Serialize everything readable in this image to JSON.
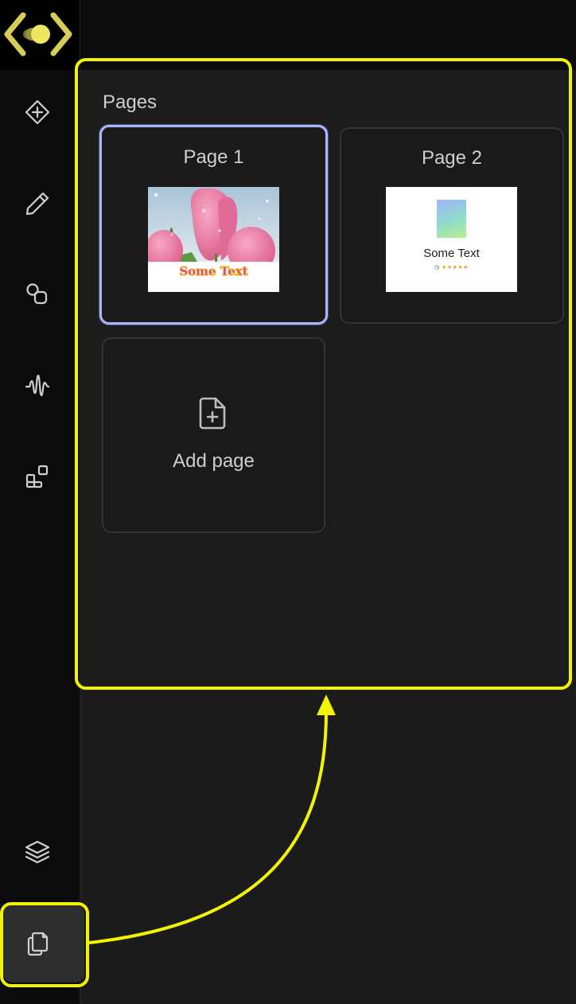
{
  "sidebar": {
    "logo_icon": "bracket-eye-logo",
    "nav_items": [
      {
        "name": "add-element-icon"
      },
      {
        "name": "pencil-icon"
      },
      {
        "name": "shapes-icon"
      },
      {
        "name": "audio-wave-icon"
      },
      {
        "name": "widgets-icon"
      },
      {
        "name": "layers-icon"
      },
      {
        "name": "pages-icon",
        "active": true
      }
    ]
  },
  "pages_panel": {
    "title": "Pages",
    "pages": [
      {
        "label": "Page 1",
        "thumbnail_text": "Some Text",
        "selected": true
      },
      {
        "label": "Page 2",
        "thumbnail_text": "Some Text",
        "thumbnail_rating": "★★★★★",
        "selected": false
      }
    ],
    "add_page_label": "Add page"
  },
  "annotation": {
    "highlight_color": "#f3f400"
  },
  "colors": {
    "accent_selected": "#a9b6ff",
    "logo_yellow": "#f0e65a"
  }
}
